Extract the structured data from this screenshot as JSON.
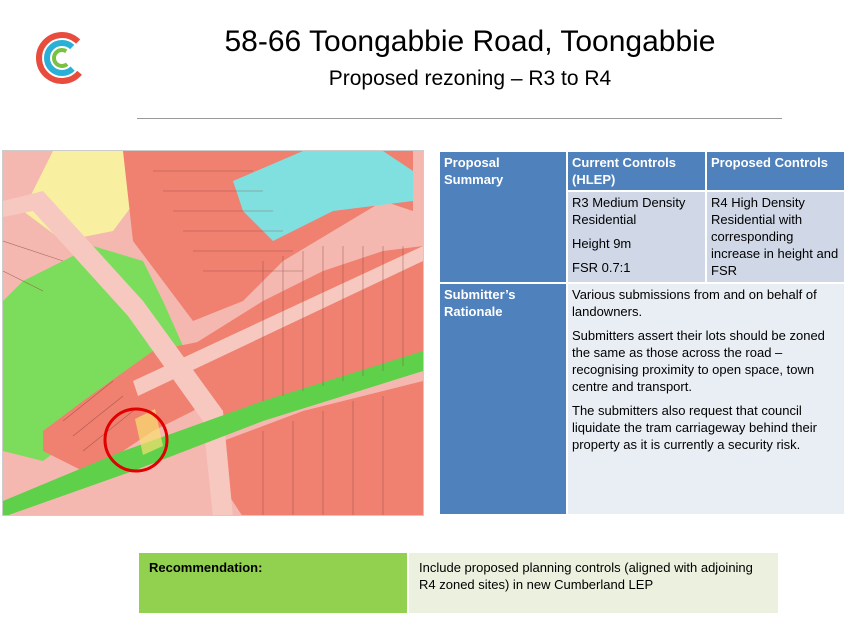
{
  "header": {
    "title": "58-66 Toongabbie Road, Toongabbie",
    "subtitle": "Proposed rezoning – R3 to R4"
  },
  "logo": {
    "icon": "council-c-logo-icon",
    "colors": [
      "#e84c3d",
      "#2ab0d6",
      "#7ac143"
    ]
  },
  "table": {
    "headers": {
      "summary": "Proposal Summary",
      "current": "Current Controls (HLEP)",
      "proposed": "Proposed Controls"
    },
    "current_controls": [
      "R3 Medium Density Residential",
      "Height 9m",
      "FSR 0.7:1"
    ],
    "proposed_controls": "R4 High Density Residential with corresponding increase in height and FSR",
    "rationale_label": "Submitter’s Rationale",
    "rationale": [
      "Various submissions from and on behalf of landowners.",
      "Submitters assert their lots should be zoned the same as those across the road – recognising proximity to open space, town centre and transport.",
      "The submitters also request that council liquidate the tram carriageway behind their property as it is currently a security risk."
    ]
  },
  "recommendation": {
    "label": "Recommendation:",
    "text": "Include proposed planning controls (aligned with adjoining R4 zoned sites) in new Cumberland LEP"
  },
  "colors": {
    "header_blue": "#4f81bd",
    "cell_blue": "#d0d8e8",
    "cell_light": "#e9edf4",
    "rec_green": "#92d050",
    "rec_light": "#ebf1de",
    "zone_r3": "#f4b8b0",
    "zone_r4": "#f08070",
    "zone_re1": "#7cdc5c",
    "zone_b": "#80e0e0",
    "zone_yellow": "#f8f0a0",
    "site_circle": "#e00000"
  }
}
